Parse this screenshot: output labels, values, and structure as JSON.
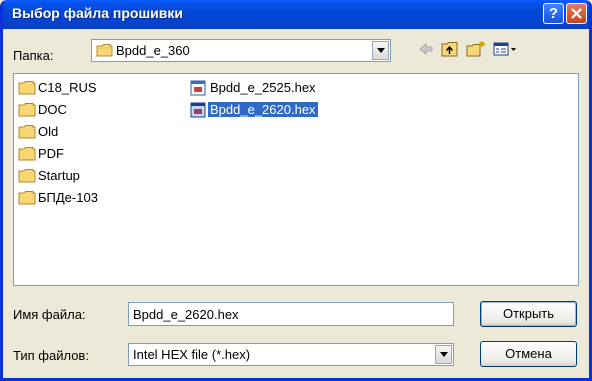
{
  "window": {
    "title": "Выбор файла прошивки"
  },
  "lookin": {
    "label": "Папка:",
    "value": "Bpdd_e_360"
  },
  "toolbar": {
    "back_icon": "back-arrow-icon",
    "up_icon": "up-folder-icon",
    "new_icon": "new-folder-icon",
    "view_icon": "view-menu-icon"
  },
  "files": {
    "folders": [
      {
        "name": "C18_RUS"
      },
      {
        "name": "DOC"
      },
      {
        "name": "Old"
      },
      {
        "name": "PDF"
      },
      {
        "name": "Startup"
      },
      {
        "name": "БПДе-103"
      }
    ],
    "hex_files": [
      {
        "name": "Bpdd_e_2525.hex"
      },
      {
        "name": "Bpdd_e_2620.hex"
      }
    ]
  },
  "filename": {
    "label": "Имя файла:",
    "value": "Bpdd_e_2620.hex"
  },
  "filetype": {
    "label": "Тип файлов:",
    "value": "Intel HEX file (*.hex)"
  },
  "buttons": {
    "open": "Открыть",
    "cancel": "Отмена"
  },
  "colors": {
    "titlebar": "#0a3fc4",
    "selection": "#316ac5",
    "face": "#ece9d8"
  }
}
